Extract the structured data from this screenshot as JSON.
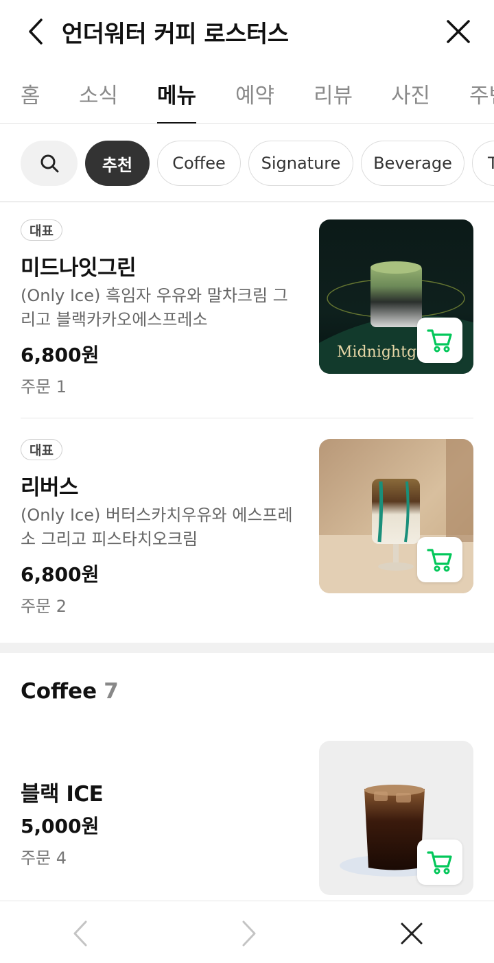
{
  "header": {
    "title": "언더워터 커피 로스터스"
  },
  "tabs": [
    {
      "label": "홈",
      "active": false
    },
    {
      "label": "소식",
      "active": false
    },
    {
      "label": "메뉴",
      "active": true
    },
    {
      "label": "예약",
      "active": false
    },
    {
      "label": "리뷰",
      "active": false
    },
    {
      "label": "사진",
      "active": false
    },
    {
      "label": "주변",
      "active": false
    }
  ],
  "chips": {
    "search_icon": "search-icon",
    "items": [
      "추천",
      "Coffee",
      "Signature",
      "Beverage",
      "T"
    ],
    "active": "추천"
  },
  "menu": {
    "items": [
      {
        "badge": "대표",
        "name": "미드나잇그린",
        "desc": "(Only Ice) 흑임자 우유와 말차크림 그리고 블랙카카오에스프레소",
        "price": "6,800원",
        "orders": "주문 1",
        "image_text": "Midnightg"
      },
      {
        "badge": "대표",
        "name": "리버스",
        "desc": "(Only Ice) 버터스카치우유와 에스프레소 그리고 피스타치오크림",
        "price": "6,800원",
        "orders": "주문 2"
      }
    ]
  },
  "coffee_section": {
    "title": "Coffee",
    "count": "7",
    "items": [
      {
        "name": "블랙 ICE",
        "price": "5,000원",
        "orders": "주문 4"
      }
    ]
  },
  "colors": {
    "accent_green": "#03c75a",
    "chip_active_bg": "#333333",
    "text_primary": "#111111",
    "text_secondary": "#666666"
  },
  "icons": {
    "back": "chevron-left-icon",
    "close": "close-icon",
    "cart": "cart-icon",
    "nav_prev": "chevron-left-icon",
    "nav_next": "chevron-right-icon",
    "nav_close": "close-icon"
  }
}
